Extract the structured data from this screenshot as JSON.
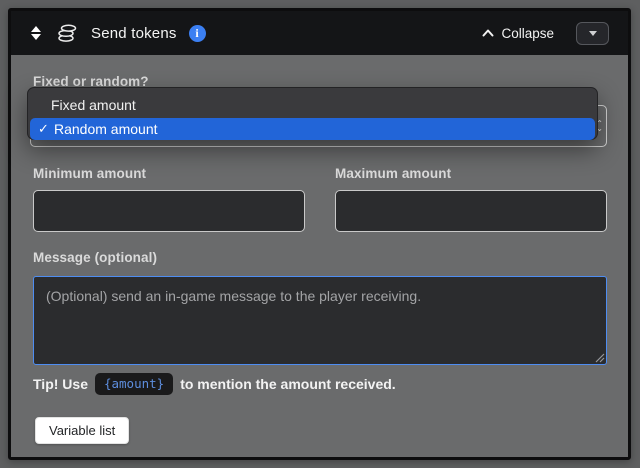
{
  "header": {
    "title": "Send tokens",
    "collapse_label": "Collapse"
  },
  "icons": {
    "drag_handle": "up-down-triangles",
    "coins": "coin-stack",
    "info_glyph": "i",
    "collapse_chevron": "chevron-up",
    "menu_caret": "caret-down",
    "checkmark": "✓",
    "select_arrow_up": "⌃",
    "select_arrow_down": "⌄"
  },
  "form": {
    "mode": {
      "label": "Fixed or random?",
      "selected_value": "Random amount",
      "options": [
        {
          "label": "Fixed amount",
          "selected": false
        },
        {
          "label": "Random amount",
          "selected": true
        }
      ]
    },
    "min_amount": {
      "label": "Minimum amount",
      "value": ""
    },
    "max_amount": {
      "label": "Maximum amount",
      "value": ""
    },
    "message": {
      "label": "Message (optional)",
      "value": "",
      "placeholder": "(Optional) send an in-game message to the player receiving."
    },
    "tip": {
      "prefix": "Tip! Use",
      "variable": "{amount}",
      "suffix": "to mention the amount received."
    },
    "variable_list_button": "Variable list"
  },
  "colors": {
    "highlight_blue": "#2265d8",
    "info_blue": "#3b7ff2",
    "focus_border": "#4e8df2",
    "code_text": "#5d8ddd",
    "header_bg": "#141517",
    "body_bg": "#6a6b6c"
  }
}
